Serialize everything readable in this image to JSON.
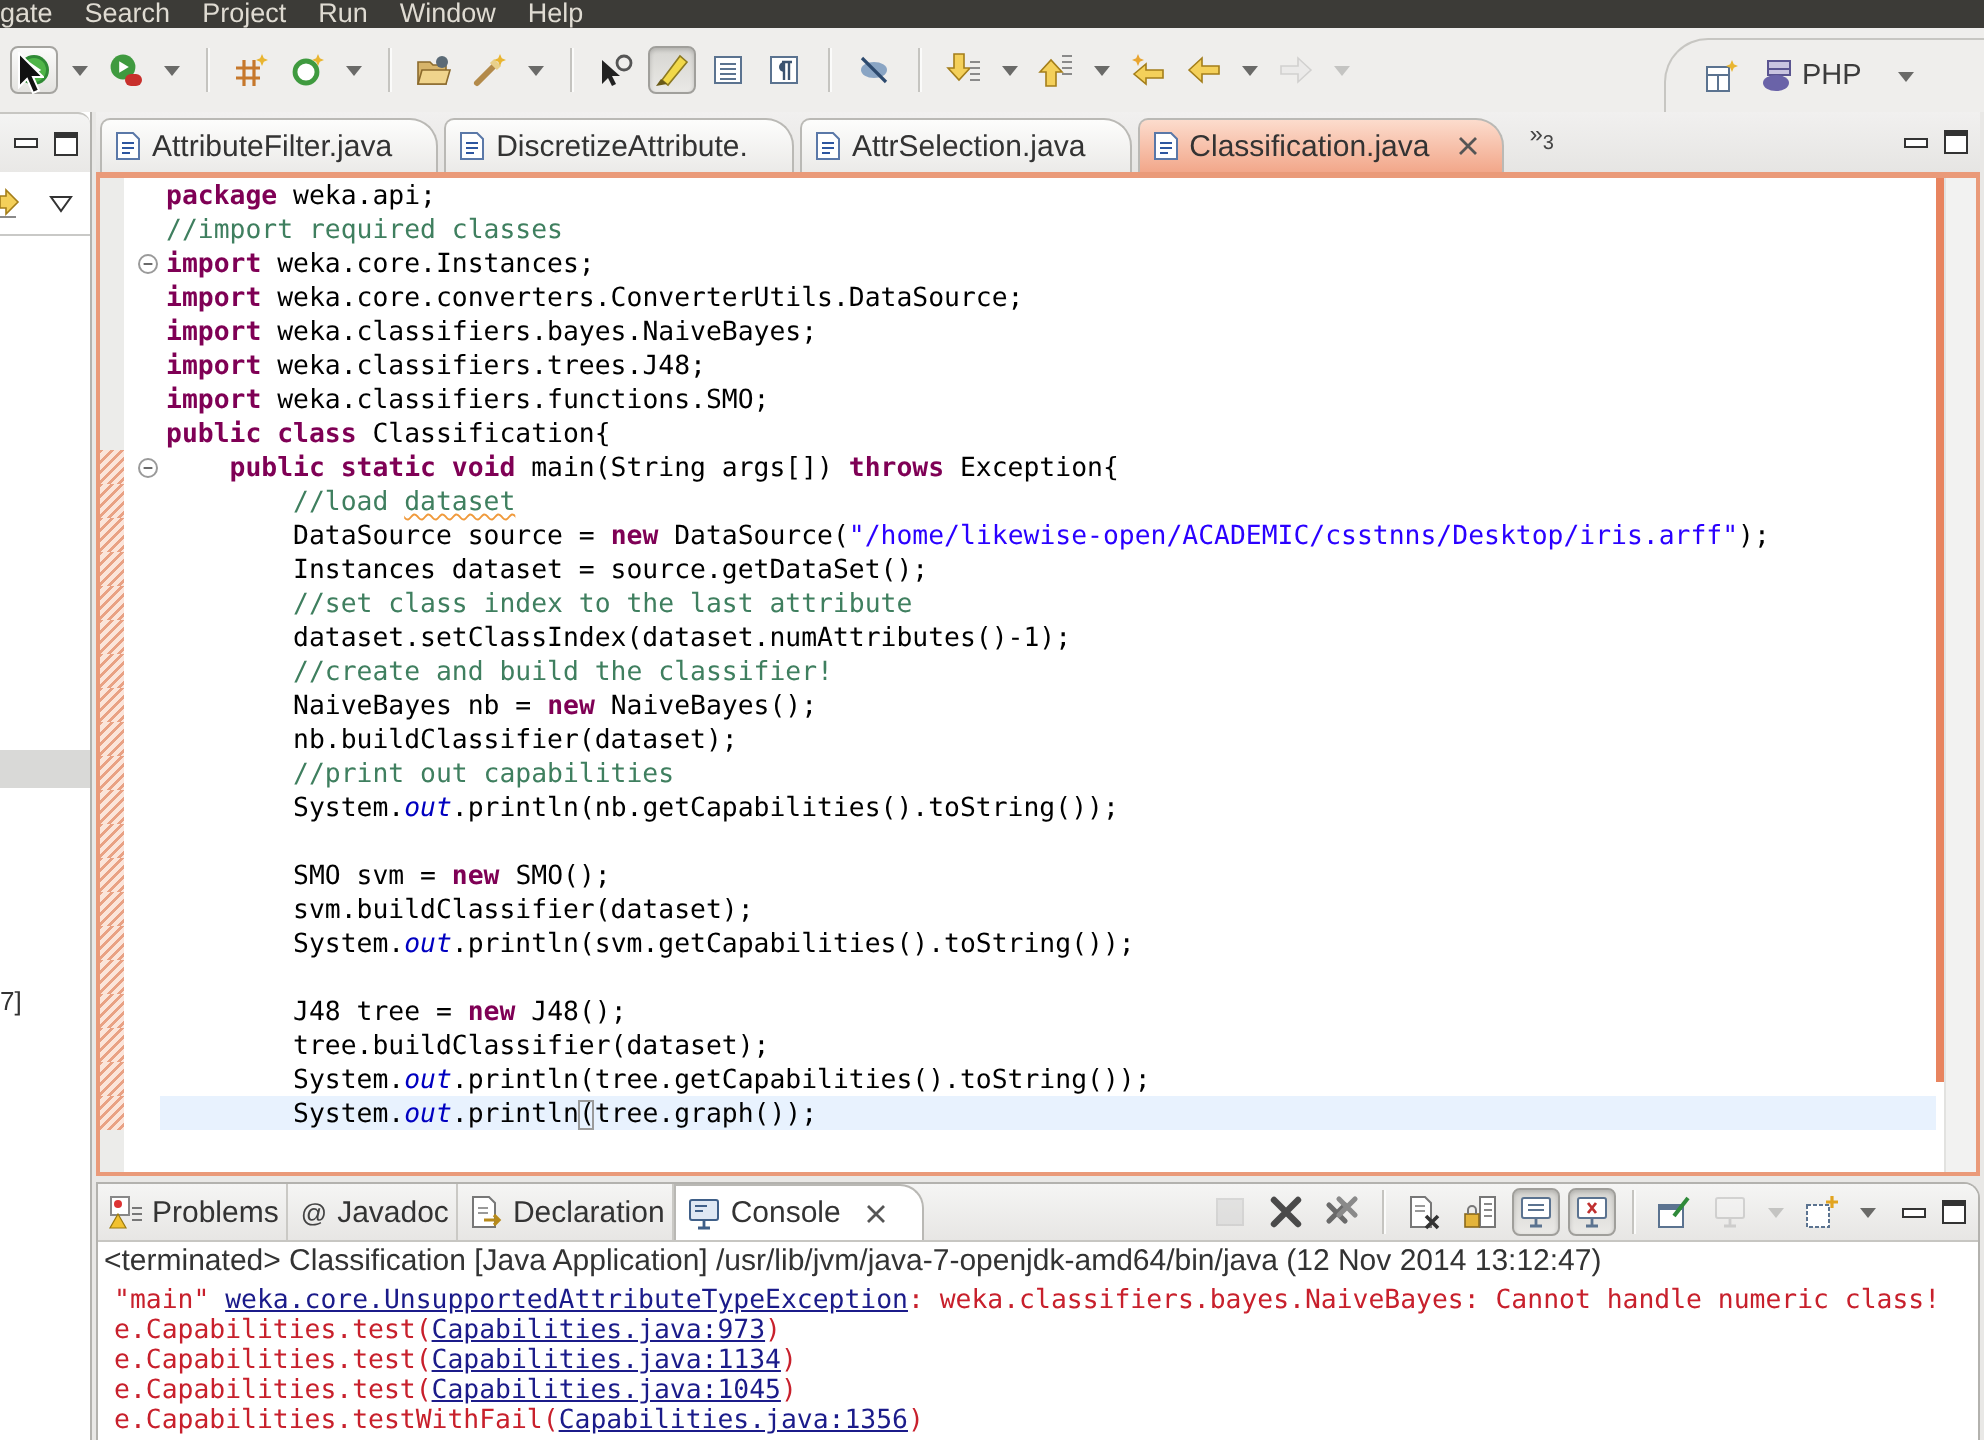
{
  "menu_bar": {
    "items": [
      "gate",
      "Search",
      "Project",
      "Run",
      "Window",
      "Help"
    ]
  },
  "toolbar": {
    "groups": [
      [
        {
          "hovered": true,
          "pressed": false,
          "disabled": false,
          "dropdown": true
        },
        {
          "hovered": false,
          "pressed": false,
          "disabled": false,
          "dropdown": true
        }
      ],
      [
        {
          "hovered": false,
          "pressed": false,
          "disabled": false,
          "dropdown": false
        },
        {
          "hovered": false,
          "pressed": false,
          "disabled": false,
          "dropdown": true
        }
      ],
      [
        {
          "hovered": false,
          "pressed": false,
          "disabled": false,
          "dropdown": false
        },
        {
          "hovered": false,
          "pressed": false,
          "disabled": false,
          "dropdown": true
        }
      ],
      [
        {
          "hovered": false,
          "pressed": false,
          "disabled": false,
          "dropdown": false
        },
        {
          "hovered": false,
          "pressed": true,
          "disabled": false,
          "dropdown": false
        },
        {
          "hovered": false,
          "pressed": false,
          "disabled": false,
          "dropdown": false
        },
        {
          "hovered": false,
          "pressed": false,
          "disabled": false,
          "dropdown": false
        }
      ],
      [
        {
          "hovered": false,
          "pressed": false,
          "disabled": false,
          "dropdown": false
        }
      ],
      [
        {
          "hovered": false,
          "pressed": false,
          "disabled": false,
          "dropdown": true
        },
        {
          "hovered": false,
          "pressed": false,
          "disabled": false,
          "dropdown": true
        },
        {
          "hovered": false,
          "pressed": false,
          "disabled": false,
          "dropdown": false
        },
        {
          "hovered": false,
          "pressed": false,
          "disabled": false,
          "dropdown": true
        },
        {
          "hovered": false,
          "pressed": false,
          "disabled": true,
          "dropdown": true
        }
      ]
    ],
    "perspective": {
      "label": "PHP"
    }
  },
  "left_panel": {
    "rows": [
      {
        "selected": true
      },
      {
        "text": "7]",
        "selected": false
      }
    ]
  },
  "editor": {
    "tabs": [
      {
        "label": "AttributeFilter.java",
        "selected": false
      },
      {
        "label": "DiscretizeAttribute.",
        "selected": false
      },
      {
        "label": "AttrSelection.java",
        "selected": false
      },
      {
        "label": "Classification.java",
        "selected": true
      }
    ],
    "overflow": "»$_{3}$",
    "lines": [
      {
        "tokens": [
          {
            "kind": "keyword",
            "text": "package"
          },
          {
            "kind": "plain",
            "text": " weka.api;"
          }
        ],
        "changed": false,
        "fold": false,
        "current": false
      },
      {
        "tokens": [
          {
            "kind": "comment",
            "text": "//import required classes"
          }
        ],
        "changed": false,
        "fold": false,
        "current": false
      },
      {
        "tokens": [
          {
            "kind": "keyword",
            "text": "import"
          },
          {
            "kind": "plain",
            "text": " weka.core.Instances;"
          }
        ],
        "changed": false,
        "fold": true,
        "current": false
      },
      {
        "tokens": [
          {
            "kind": "keyword",
            "text": "import"
          },
          {
            "kind": "plain",
            "text": " weka.core.converters.ConverterUtils.DataSource;"
          }
        ],
        "changed": false,
        "fold": false,
        "current": false
      },
      {
        "tokens": [
          {
            "kind": "keyword",
            "text": "import"
          },
          {
            "kind": "plain",
            "text": " weka.classifiers.bayes.NaiveBayes;"
          }
        ],
        "changed": false,
        "fold": false,
        "current": false
      },
      {
        "tokens": [
          {
            "kind": "keyword",
            "text": "import"
          },
          {
            "kind": "plain",
            "text": " weka.classifiers.trees.J48;"
          }
        ],
        "changed": false,
        "fold": false,
        "current": false
      },
      {
        "tokens": [
          {
            "kind": "keyword",
            "text": "import"
          },
          {
            "kind": "plain",
            "text": " weka.classifiers.functions.SMO;"
          }
        ],
        "changed": false,
        "fold": false,
        "current": false
      },
      {
        "tokens": [
          {
            "kind": "keyword",
            "text": "public class"
          },
          {
            "kind": "plain",
            "text": " Classification{"
          }
        ],
        "changed": false,
        "fold": false,
        "current": false
      },
      {
        "tokens": [
          {
            "kind": "keyword",
            "text": "    public static void"
          },
          {
            "kind": "plain",
            "text": " main(String args[]) "
          },
          {
            "kind": "keyword",
            "text": "throws"
          },
          {
            "kind": "plain",
            "text": " Exception{"
          }
        ],
        "changed": true,
        "fold": true,
        "current": false
      },
      {
        "tokens": [
          {
            "kind": "comment",
            "text": "        //load "
          },
          {
            "kind": "misspelled",
            "text": "dataset"
          }
        ],
        "changed": true,
        "fold": false,
        "current": false
      },
      {
        "tokens": [
          {
            "kind": "plain",
            "text": "        DataSource source = "
          },
          {
            "kind": "keyword",
            "text": "new"
          },
          {
            "kind": "plain",
            "text": " DataSource("
          },
          {
            "kind": "string",
            "text": "\"/home/likewise-open/ACADEMIC/csstnns/Desktop/iris.arff\""
          },
          {
            "kind": "plain",
            "text": ");"
          }
        ],
        "changed": true,
        "fold": false,
        "current": false
      },
      {
        "tokens": [
          {
            "kind": "plain",
            "text": "        Instances dataset = source.getDataSet();"
          }
        ],
        "changed": true,
        "fold": false,
        "current": false
      },
      {
        "tokens": [
          {
            "kind": "comment",
            "text": "        //set class index to the last attribute"
          }
        ],
        "changed": true,
        "fold": false,
        "current": false
      },
      {
        "tokens": [
          {
            "kind": "plain",
            "text": "        dataset.setClassIndex(dataset.numAttributes()-1);"
          }
        ],
        "changed": true,
        "fold": false,
        "current": false
      },
      {
        "tokens": [
          {
            "kind": "comment",
            "text": "        //create and build the classifier!"
          }
        ],
        "changed": true,
        "fold": false,
        "current": false
      },
      {
        "tokens": [
          {
            "kind": "plain",
            "text": "        NaiveBayes nb = "
          },
          {
            "kind": "keyword",
            "text": "new"
          },
          {
            "kind": "plain",
            "text": " NaiveBayes();"
          }
        ],
        "changed": true,
        "fold": false,
        "current": false
      },
      {
        "tokens": [
          {
            "kind": "plain",
            "text": "        nb.buildClassifier(dataset);"
          }
        ],
        "changed": true,
        "fold": false,
        "current": false
      },
      {
        "tokens": [
          {
            "kind": "comment",
            "text": "        //print out capabilities"
          }
        ],
        "changed": true,
        "fold": false,
        "current": false
      },
      {
        "tokens": [
          {
            "kind": "plain",
            "text": "        System."
          },
          {
            "kind": "field",
            "text": "out"
          },
          {
            "kind": "plain",
            "text": ".println(nb.getCapabilities().toString());"
          }
        ],
        "changed": true,
        "fold": false,
        "current": false
      },
      {
        "changed": true,
        "fold": false,
        "current": false
      },
      {
        "tokens": [
          {
            "kind": "plain",
            "text": "        SMO svm = "
          },
          {
            "kind": "keyword",
            "text": "new"
          },
          {
            "kind": "plain",
            "text": " SMO();"
          }
        ],
        "changed": true,
        "fold": false,
        "current": false
      },
      {
        "tokens": [
          {
            "kind": "plain",
            "text": "        svm.buildClassifier(dataset);"
          }
        ],
        "changed": true,
        "fold": false,
        "current": false
      },
      {
        "tokens": [
          {
            "kind": "plain",
            "text": "        System."
          },
          {
            "kind": "field",
            "text": "out"
          },
          {
            "kind": "plain",
            "text": ".println(svm.getCapabilities().toString());"
          }
        ],
        "changed": true,
        "fold": false,
        "current": false
      },
      {
        "changed": true,
        "fold": false,
        "current": false
      },
      {
        "tokens": [
          {
            "kind": "plain",
            "text": "        J48 tree = "
          },
          {
            "kind": "keyword",
            "text": "new"
          },
          {
            "kind": "plain",
            "text": " J48();"
          }
        ],
        "changed": true,
        "fold": false,
        "current": false
      },
      {
        "tokens": [
          {
            "kind": "plain",
            "text": "        tree.buildClassifier(dataset);"
          }
        ],
        "changed": true,
        "fold": false,
        "current": false
      },
      {
        "tokens": [
          {
            "kind": "plain",
            "text": "        System."
          },
          {
            "kind": "field",
            "text": "out"
          },
          {
            "kind": "plain",
            "text": ".println(tree.getCapabilities().toString());"
          }
        ],
        "changed": true,
        "fold": false,
        "current": false
      },
      {
        "tokens": [
          {
            "kind": "plain",
            "text": "        System."
          },
          {
            "kind": "field",
            "text": "out"
          },
          {
            "kind": "plain",
            "text": ".println"
          },
          {
            "kind": "bracket",
            "text": "("
          },
          {
            "kind": "plain",
            "text": "tree.graph());"
          }
        ],
        "changed": true,
        "fold": false,
        "current": true
      }
    ]
  },
  "console_panel": {
    "tabs": [
      {
        "label": "Problems",
        "selected": false
      },
      {
        "label": "Javadoc",
        "glyph": "@",
        "selected": false
      },
      {
        "label": "Declaration",
        "selected": false
      },
      {
        "label": "Console",
        "selected": true
      }
    ],
    "toolbar": {
      "groups": [
        [
          {
            "hovered": false,
            "pressed": false,
            "disabled": true,
            "dropdown": false
          },
          {
            "hovered": false,
            "pressed": false,
            "disabled": false,
            "dropdown": false
          },
          {
            "hovered": false,
            "pressed": false,
            "disabled": false,
            "dropdown": false
          }
        ],
        [
          {
            "hovered": false,
            "pressed": false,
            "disabled": false,
            "dropdown": false
          },
          {
            "hovered": false,
            "pressed": false,
            "disabled": false,
            "dropdown": false
          },
          {
            "hovered": false,
            "pressed": true,
            "disabled": false,
            "dropdown": false
          },
          {
            "hovered": false,
            "pressed": true,
            "disabled": false,
            "dropdown": false
          }
        ],
        [
          {
            "hovered": false,
            "pressed": false,
            "disabled": false,
            "dropdown": false
          },
          {
            "hovered": false,
            "pressed": false,
            "disabled": true,
            "dropdown": true
          },
          {
            "hovered": false,
            "pressed": false,
            "disabled": false,
            "dropdown": true
          }
        ]
      ]
    },
    "header": "<terminated> Classification [Java Application] /usr/lib/jvm/java-7-openjdk-amd64/bin/java (12 Nov 2014 13:12:47)",
    "output": [
      {
        "tokens": [
          {
            "kind": "text",
            "text": "\"main\" "
          },
          {
            "kind": "link",
            "text": "weka.core.UnsupportedAttributeTypeException"
          },
          {
            "kind": "text",
            "text": ": weka.classifiers.bayes.NaiveBayes: Cannot handle numeric class!"
          }
        ]
      },
      {
        "tokens": [
          {
            "kind": "text",
            "text": "e.Capabilities.test("
          },
          {
            "kind": "link",
            "text": "Capabilities.java:973"
          },
          {
            "kind": "text",
            "text": ")"
          }
        ]
      },
      {
        "tokens": [
          {
            "kind": "text",
            "text": "e.Capabilities.test("
          },
          {
            "kind": "link",
            "text": "Capabilities.java:1134"
          },
          {
            "kind": "text",
            "text": ")"
          }
        ]
      },
      {
        "tokens": [
          {
            "kind": "text",
            "text": "e.Capabilities.test("
          },
          {
            "kind": "link",
            "text": "Capabilities.java:1045"
          },
          {
            "kind": "text",
            "text": ")"
          }
        ]
      },
      {
        "tokens": [
          {
            "kind": "text",
            "text": "e.Capabilities.testWithFail("
          },
          {
            "kind": "link",
            "text": "Capabilities.java:1356"
          },
          {
            "kind": "text",
            "text": ")"
          }
        ]
      }
    ]
  }
}
